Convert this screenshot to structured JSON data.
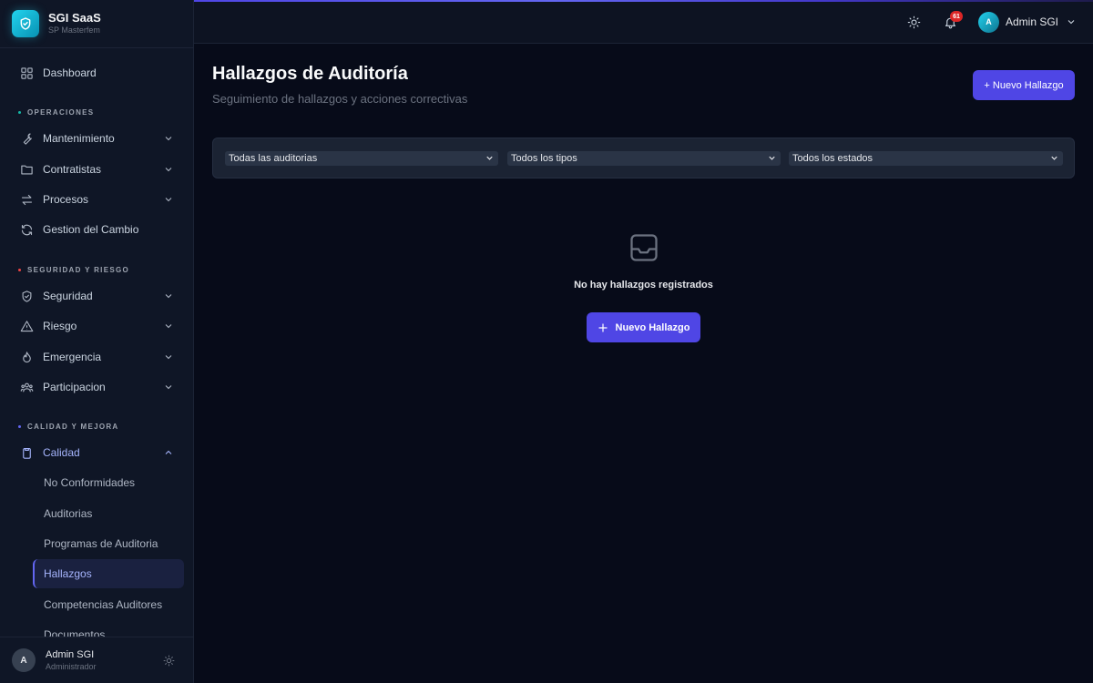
{
  "brand": {
    "name": "SGI SaaS",
    "subtitle": "SP Masterfem",
    "icon": "shield-check-icon"
  },
  "sidebar": {
    "dashboard": "Dashboard",
    "sections": [
      {
        "label": "OPERACIONES",
        "dot_color": "#14b8a6"
      },
      {
        "label": "SEGURIDAD Y RIESGO",
        "dot_color": "#ef4444"
      },
      {
        "label": "CALIDAD Y MEJORA",
        "dot_color": "#6366f1"
      }
    ],
    "items": [
      {
        "label": "Mantenimiento",
        "icon": "wrench-icon"
      },
      {
        "label": "Contratistas",
        "icon": "folder-icon"
      },
      {
        "label": "Procesos",
        "icon": "arrows-icon"
      },
      {
        "label": "Gestion del Cambio",
        "icon": "refresh-icon"
      },
      {
        "label": "Seguridad",
        "icon": "shield-icon"
      },
      {
        "label": "Riesgo",
        "icon": "warning-icon"
      },
      {
        "label": "Emergencia",
        "icon": "flame-icon"
      },
      {
        "label": "Participacion",
        "icon": "users-icon"
      },
      {
        "label": "Calidad",
        "icon": "clipboard-icon"
      }
    ],
    "calidad_sub": [
      "No Conformidades",
      "Auditorias",
      "Programas de Auditoria",
      "Hallazgos",
      "Competencias Auditores",
      "Documentos"
    ],
    "active_sub": "Hallazgos",
    "footer": {
      "avatar": "A",
      "name": "Admin SGI",
      "role": "Administrador"
    }
  },
  "topbar": {
    "notifications_count": "61",
    "user_avatar": "A",
    "user_name": "Admin SGI"
  },
  "page": {
    "title": "Hallazgos de Auditoría",
    "subtitle": "Seguimiento de hallazgos y acciones correctivas",
    "new_button": "+ Nuevo Hallazgo"
  },
  "filters": {
    "auditoria": "Todas las auditorias",
    "tipo": "Todos los tipos",
    "estado": "Todos los estados"
  },
  "empty_state": {
    "message": "No hay hallazgos registrados",
    "button": "Nuevo Hallazgo"
  },
  "colors": {
    "accent": "#4f46e5",
    "active_text": "#a5b4fc",
    "background": "#070b19",
    "sidebar": "#0f1626"
  }
}
